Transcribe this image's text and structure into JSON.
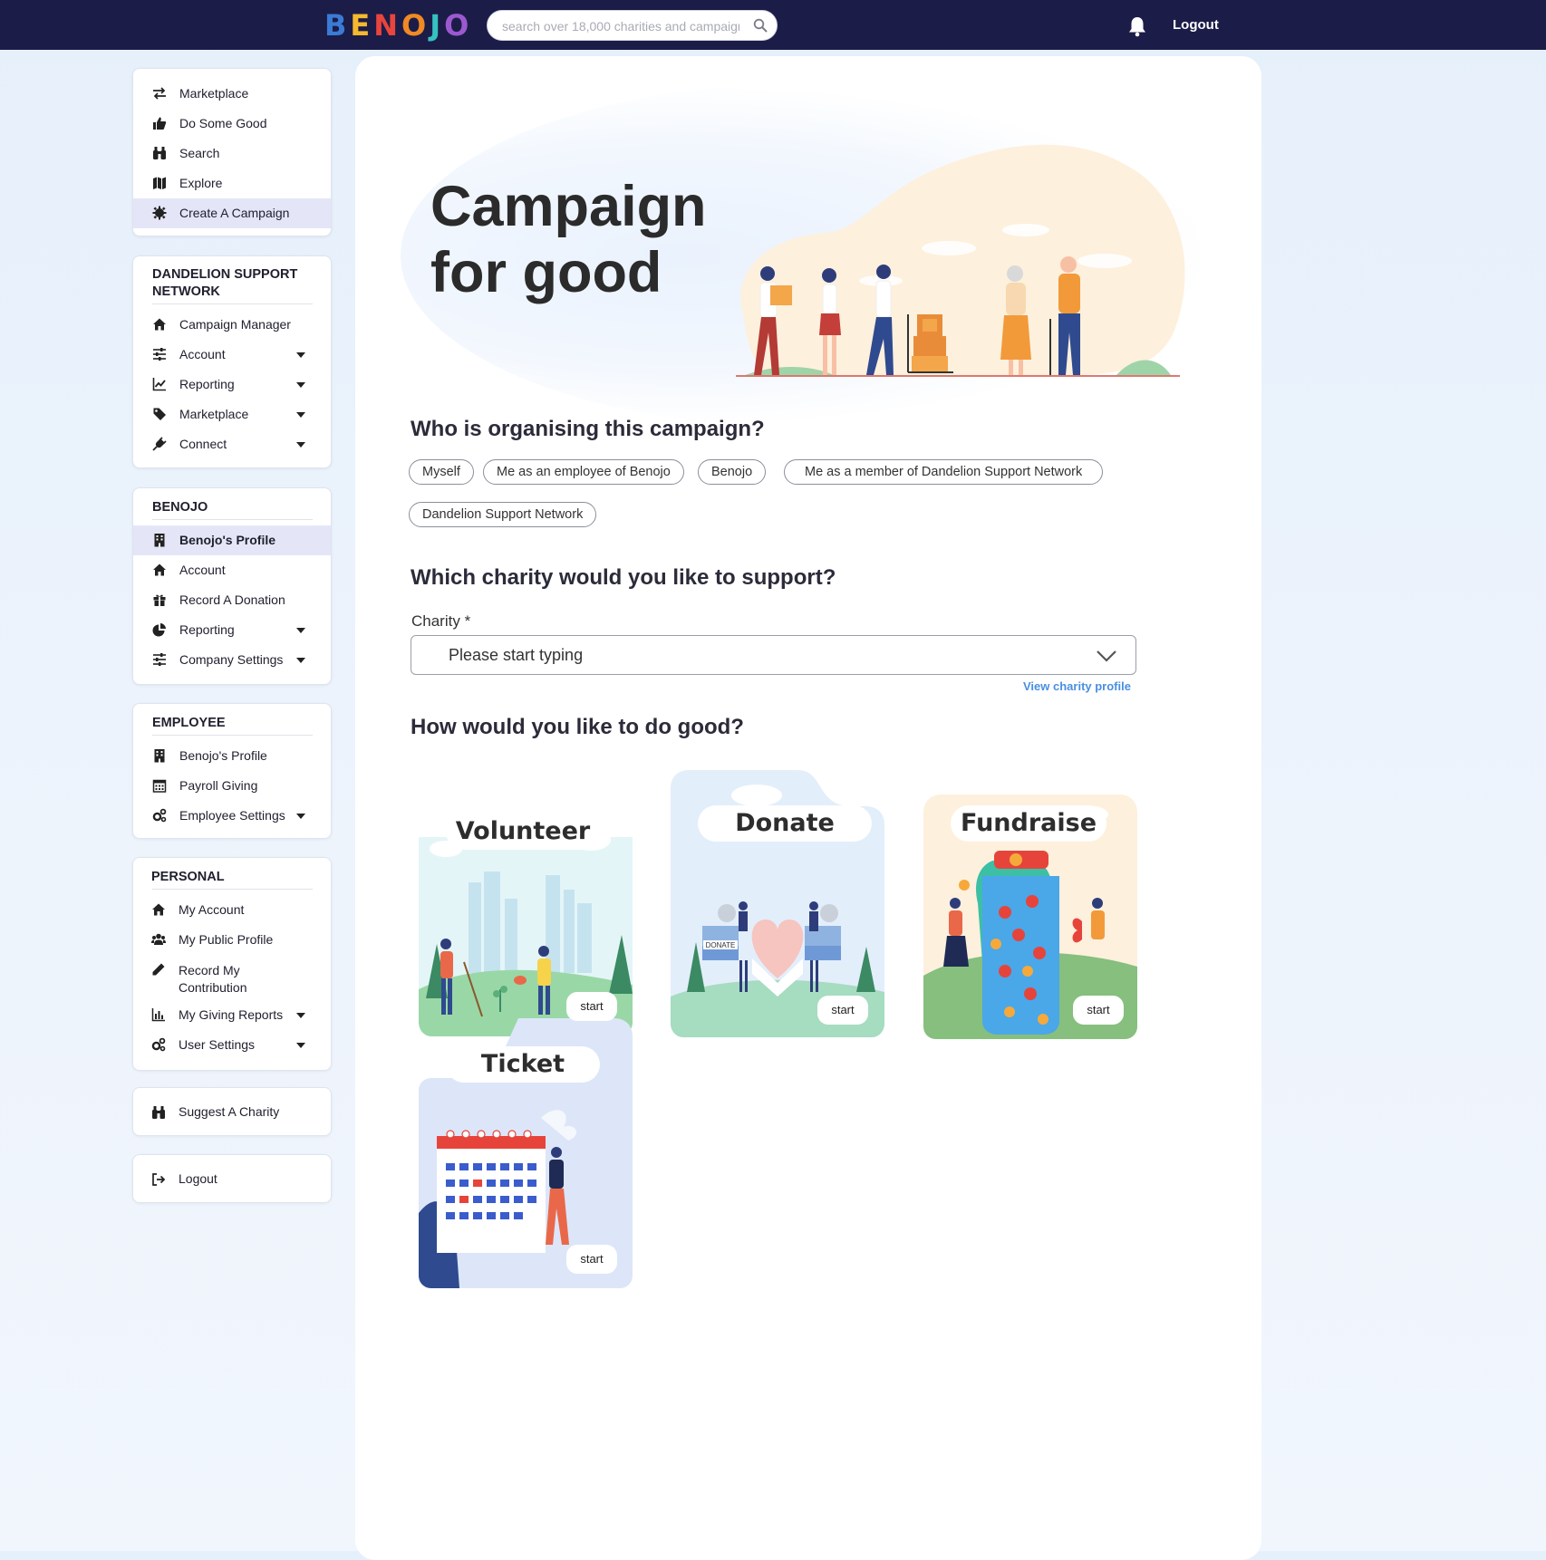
{
  "header": {
    "logo_letters": [
      "B",
      "E",
      "N",
      "O",
      "J",
      "O"
    ],
    "logo_colors": [
      "#3a7bd5",
      "#f5b82e",
      "#e8453c",
      "#f08a24",
      "#35c2c1",
      "#9b59d0"
    ],
    "search_placeholder": "search over 18,000 charities and campaigns",
    "logout_label": "Logout",
    "bg_color": "#1c1c48"
  },
  "sidebar": {
    "main_nav": [
      {
        "label": "Marketplace",
        "icon": "exchange-icon"
      },
      {
        "label": "Do Some Good",
        "icon": "thumbs-up-icon"
      },
      {
        "label": "Search",
        "icon": "binoculars-icon"
      },
      {
        "label": "Explore",
        "icon": "map-icon"
      },
      {
        "label": "Create A Campaign",
        "icon": "gear-icon",
        "active": true
      }
    ],
    "dandelion": {
      "title_line1": "DANDELION SUPPORT",
      "title_line2": "NETWORK",
      "items": [
        {
          "label": "Campaign Manager",
          "icon": "home-icon"
        },
        {
          "label": "Account",
          "icon": "sliders-icon",
          "caret": true
        },
        {
          "label": "Reporting",
          "icon": "line-chart-icon",
          "caret": true
        },
        {
          "label": "Marketplace",
          "icon": "tag-icon",
          "caret": true
        },
        {
          "label": "Connect",
          "icon": "plug-icon",
          "caret": true
        }
      ]
    },
    "benojo": {
      "title": "BENOJO",
      "items": [
        {
          "label": "Benojo's Profile",
          "icon": "building-icon",
          "active": true
        },
        {
          "label": "Account",
          "icon": "home-icon"
        },
        {
          "label": "Record A Donation",
          "icon": "gift-icon"
        },
        {
          "label": "Reporting",
          "icon": "pie-chart-icon",
          "caret": true
        },
        {
          "label": "Company Settings",
          "icon": "sliders-icon",
          "caret": true
        }
      ]
    },
    "employee": {
      "title": "EMPLOYEE",
      "items": [
        {
          "label": "Benojo's Profile",
          "icon": "building-icon"
        },
        {
          "label": "Payroll Giving",
          "icon": "calendar-icon"
        },
        {
          "label": "Employee Settings",
          "icon": "cogs-icon",
          "caret": true
        }
      ]
    },
    "personal": {
      "title": "PERSONAL",
      "items": [
        {
          "label": "My Account",
          "icon": "home-icon"
        },
        {
          "label": "My Public Profile",
          "icon": "users-icon"
        },
        {
          "label_line1": "Record My",
          "label_line2": "Contribution",
          "icon": "pencil-icon"
        },
        {
          "label": "My Giving Reports",
          "icon": "bar-chart-icon",
          "caret": true
        },
        {
          "label": "User Settings",
          "icon": "cogs-icon",
          "caret": true
        }
      ]
    },
    "suggest": {
      "label": "Suggest A Charity",
      "icon": "binoculars-icon"
    },
    "logout": {
      "label": "Logout",
      "icon": "sign-out-icon"
    }
  },
  "main": {
    "hero_line1": "Campaign",
    "hero_line2": "for good",
    "q_organiser": "Who is organising this campaign?",
    "organiser_chips": [
      "Myself",
      "Me as an employee of Benojo",
      "Benojo",
      "Me as a member of Dandelion Support Network",
      "Dandelion Support Network"
    ],
    "q_charity": "Which charity would you like to support?",
    "charity_label": "Charity *",
    "charity_placeholder": "Please start typing",
    "view_profile_link": "View charity profile",
    "q_how": "How would you like to do good?",
    "tiles": [
      {
        "title": "Volunteer",
        "start": "start"
      },
      {
        "title": "Donate",
        "start": "start"
      },
      {
        "title": "Fundraise",
        "start": "start"
      },
      {
        "title": "Ticket",
        "start": "start"
      }
    ],
    "tile_sign_text": "DONATE"
  }
}
